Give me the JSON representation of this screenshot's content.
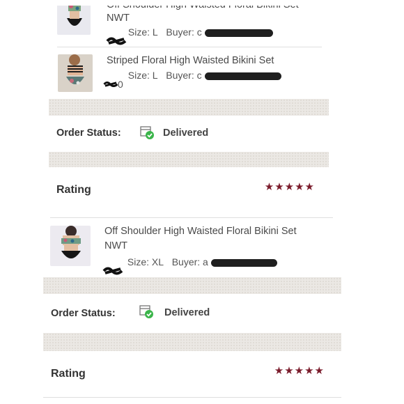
{
  "screenshot_top": {
    "items": [
      {
        "title_line1": "Off Shoulder High Waisted Floral Bikini Set",
        "title_line2": "NWT",
        "size_label": "Size: L",
        "buyer_label": "Buyer: c"
      },
      {
        "title_line1": "Striped Floral High Waisted Bikini Set",
        "price_fragment": "0",
        "size_label": "Size: L",
        "buyer_label": "Buyer: c"
      }
    ],
    "order_status_label": "Order Status:",
    "order_status_value": "Delivered",
    "rating_label": "Rating",
    "rating_stars": "★★★★★"
  },
  "screenshot_bottom": {
    "items": [
      {
        "title_line1": "Off Shoulder High Waisted Floral Bikini Set",
        "title_line2": "NWT",
        "size_label": "Size: XL",
        "buyer_label": "Buyer: a"
      }
    ],
    "order_status_label": "Order Status:",
    "order_status_value": "Delivered",
    "rating_label": "Rating",
    "rating_stars": "★★★★★"
  },
  "icons": {
    "package": "package-delivered-icon",
    "check": "check-circle-icon",
    "star": "star-icon"
  },
  "colors": {
    "star": "#7b1c2c",
    "check": "#3bb54a",
    "band": "#ebe8e4"
  }
}
